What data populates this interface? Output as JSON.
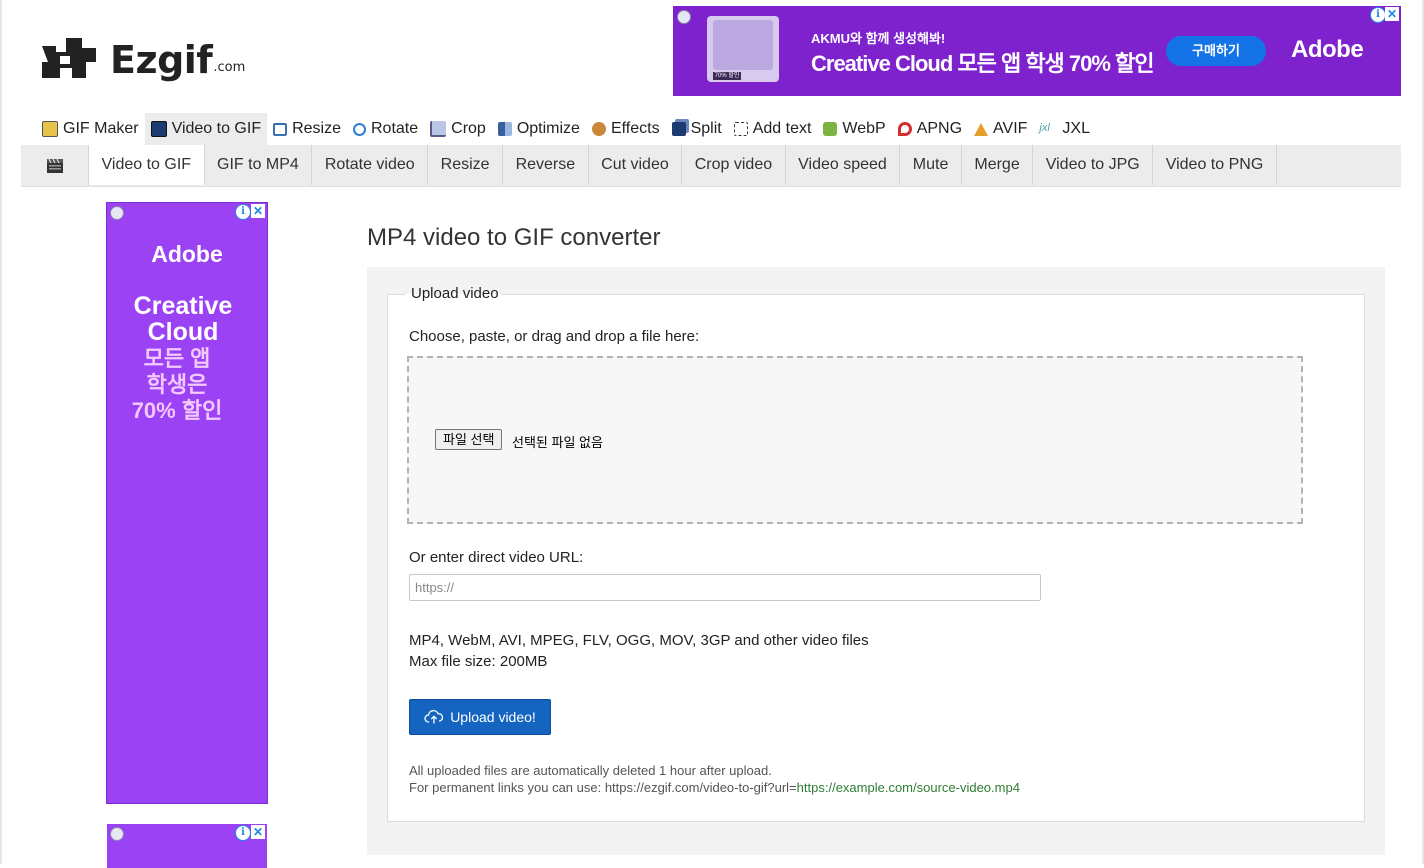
{
  "logo": {
    "name": "Ezgif",
    "suffix": ".com"
  },
  "top_ad": {
    "line1": "AKMU와 함께 생성해봐!",
    "line2": "Creative Cloud 모든 앱 학생 70% 할인",
    "image_tag": "70% 할인",
    "cta": "구매하기",
    "brand": "Adobe"
  },
  "main_nav": [
    {
      "label": "GIF Maker",
      "icon": "gif-maker-icon",
      "color": "#d8a400"
    },
    {
      "label": "Video to GIF",
      "icon": "video-to-gif-icon",
      "color": "#1d3b73"
    },
    {
      "label": "Resize",
      "icon": "resize-icon",
      "color": "#3a6fb0"
    },
    {
      "label": "Rotate",
      "icon": "rotate-icon",
      "color": "#2f7dd1"
    },
    {
      "label": "Crop",
      "icon": "crop-icon",
      "color": "#5a5a8a"
    },
    {
      "label": "Optimize",
      "icon": "optimize-icon",
      "color": "#3a5fa0"
    },
    {
      "label": "Effects",
      "icon": "effects-icon",
      "color": "#c9873a"
    },
    {
      "label": "Split",
      "icon": "split-icon",
      "color": "#1d3b73"
    },
    {
      "label": "Add text",
      "icon": "add-text-icon",
      "color": "#3a3a3a"
    },
    {
      "label": "WebP",
      "icon": "webp-icon",
      "color": "#7cb342"
    },
    {
      "label": "APNG",
      "icon": "apng-icon",
      "color": "#d32f2f"
    },
    {
      "label": "AVIF",
      "icon": "avif-icon",
      "color": "#e5a02a"
    },
    {
      "label": "JXL",
      "icon": "jxl-icon",
      "color": "#4aa3a3"
    }
  ],
  "sub_nav": [
    "Video to GIF",
    "GIF to MP4",
    "Rotate video",
    "Resize",
    "Reverse",
    "Cut video",
    "Crop video",
    "Video speed",
    "Mute",
    "Merge",
    "Video to JPG",
    "Video to PNG"
  ],
  "left_ad": {
    "brand": "Adobe",
    "line1": "Creative",
    "line2": "Cloud",
    "line3": "모든 앱",
    "line4": "학생은",
    "line5": "70% 할인"
  },
  "main": {
    "title": "MP4 video to GIF converter",
    "legend": "Upload video",
    "choose_label": "Choose, paste, or drag and drop a file here:",
    "file_button": "파일 선택",
    "file_status": "선택된 파일 없음",
    "url_label": "Or enter direct video URL:",
    "url_placeholder": "https://",
    "formats_line": "MP4, WebM, AVI, MPEG, FLV, OGG, MOV, 3GP and other video files",
    "max_size": "Max file size: 200MB",
    "upload_button": "Upload video!",
    "note_line1": "All uploaded files are automatically deleted 1 hour after upload.",
    "note_line2_prefix": "For permanent links you can use: https://ezgif.com/video-to-gif?url=",
    "note_line2_link": "https://example.com/source-video.mp4"
  },
  "colors": {
    "ad_purple": "#7e22ce",
    "ad_purple_light": "#9b42f5",
    "primary_button": "#1565c0",
    "link_green": "#2e7d32"
  }
}
